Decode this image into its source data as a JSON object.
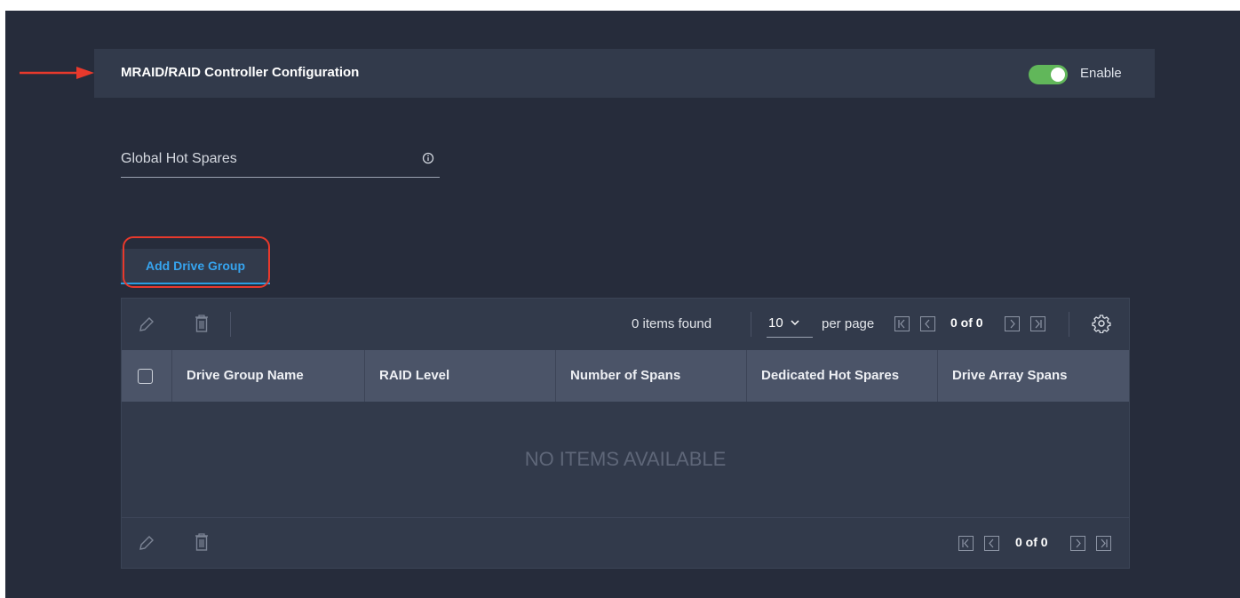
{
  "section": {
    "title": "MRAID/RAID Controller Configuration",
    "toggle_label": "Enable",
    "toggle_on": true
  },
  "field": {
    "label": "Global Hot Spares",
    "info_icon": "info-circle-icon"
  },
  "add_button": {
    "label": "Add Drive Group"
  },
  "toolbar": {
    "edit_icon": "pencil-icon",
    "delete_icon": "trash-icon",
    "items_found": "0 items found",
    "per_page_value": "10",
    "per_page_label": "per page",
    "page_status": "0 of 0",
    "settings_icon": "gear-icon"
  },
  "table": {
    "columns": [
      "Drive Group Name",
      "RAID Level",
      "Number of Spans",
      "Dedicated Hot Spares",
      "Drive Array Spans"
    ],
    "empty_message": "NO ITEMS AVAILABLE"
  },
  "footer": {
    "page_status": "0 of 0"
  },
  "colors": {
    "background": "#262c3b",
    "panel": "#323a4b",
    "header_row": "#4b5468",
    "accent": "#36a4ef",
    "toggle_on": "#61b75a",
    "annotation": "#e8392c"
  }
}
